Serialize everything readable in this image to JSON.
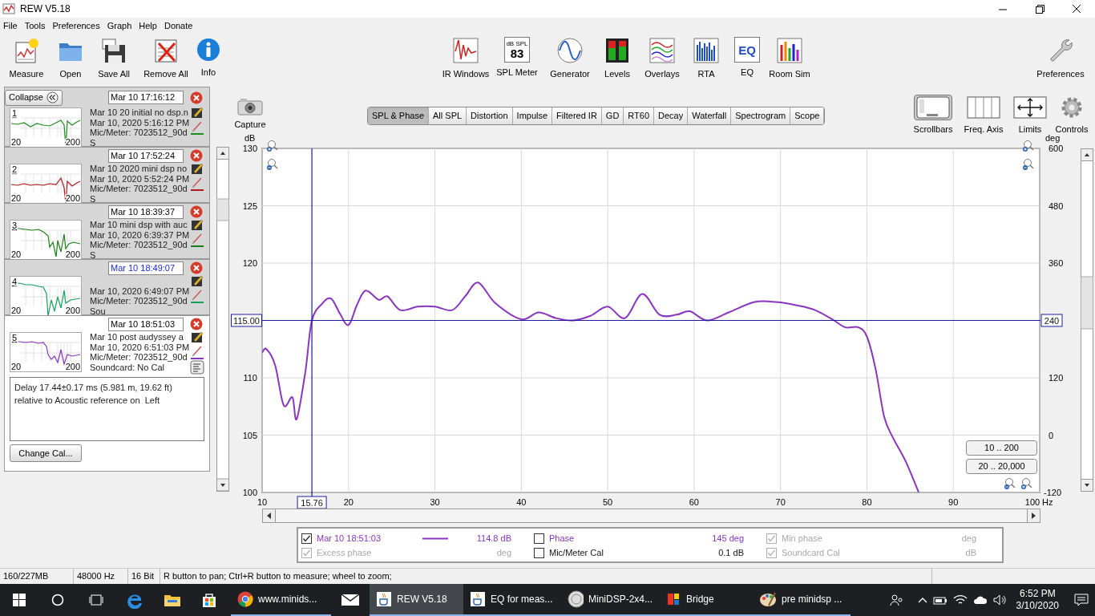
{
  "window": {
    "title": "REW V5.18"
  },
  "menu": [
    "File",
    "Tools",
    "Preferences",
    "Graph",
    "Help",
    "Donate"
  ],
  "toolbar": {
    "left": [
      {
        "label": "Measure"
      },
      {
        "label": "Open"
      },
      {
        "label": "Save All"
      },
      {
        "label": "Remove All"
      },
      {
        "label": "Info"
      }
    ],
    "center": [
      {
        "label": "IR Windows"
      },
      {
        "label": "SPL Meter",
        "icon_caption": "dB SPL",
        "icon_text": "83"
      },
      {
        "label": "Generator"
      },
      {
        "label": "Levels"
      },
      {
        "label": "Overlays"
      },
      {
        "label": "RTA"
      },
      {
        "label": "EQ",
        "icon_text": "EQ"
      },
      {
        "label": "Room Sim"
      }
    ],
    "right": [
      {
        "label": "Preferences"
      }
    ]
  },
  "measurements_panel": {
    "collapse_label": "Collapse",
    "measurements": [
      {
        "number": "1",
        "timestamp": "Mar 10 17:16:12",
        "timestamp_highlighted": false,
        "name": "Mar 10 20 initial no dsp.n",
        "date": "Mar 10, 2020 5:16:12 PM",
        "mic": "Mic/Meter: 7023512_90d",
        "soundcard": "S",
        "thumb_axis": [
          "20",
          "200"
        ],
        "color": "#1e8c1e",
        "selected": false
      },
      {
        "number": "2",
        "timestamp": "Mar 10 17:52:24",
        "timestamp_highlighted": false,
        "name": "Mar 10 2020 mini dsp no",
        "date": "Mar 10, 2020 5:52:24 PM",
        "mic": "Mic/Meter: 7023512_90d",
        "soundcard": "S",
        "thumb_axis": [
          "20",
          "200"
        ],
        "color": "#b01818",
        "selected": false
      },
      {
        "number": "3",
        "timestamp": "Mar 10 18:39:37",
        "timestamp_highlighted": false,
        "name": "Mar 10 mini dsp with auc",
        "date": "Mar 10, 2020 6:39:37 PM",
        "mic": "Mic/Meter: 7023512_90d",
        "soundcard": "S",
        "thumb_axis": [
          "20",
          "200"
        ],
        "color": "#1a7f1a",
        "selected": false
      },
      {
        "number": "4",
        "timestamp": "Mar 10 18:49:07",
        "timestamp_highlighted": true,
        "date": "Mar 10, 2020 6:49:07 PM",
        "mic": "Mic/Meter: 7023512_90d",
        "soundcard": "Sou",
        "thumb_axis": [
          "20",
          "200"
        ],
        "color": "#16a05e",
        "selected": false
      },
      {
        "number": "5",
        "timestamp": "Mar 10 18:51:03",
        "timestamp_highlighted": false,
        "name": "Mar 10 post audyssey a",
        "date": "Mar 10, 2020 6:51:03 PM",
        "mic": "Mic/Meter: 7023512_90d",
        "soundcard": "Soundcard: No Cal",
        "thumb_axis": [
          "20",
          "200"
        ],
        "color": "#8a35c0",
        "selected": true
      }
    ],
    "info_text": [
      "Delay 17.44±0.17 ms (5.981 m, 19.62 ft)",
      "relative to Acoustic reference on  Left"
    ],
    "change_cal_button": "Change Cal..."
  },
  "capture": {
    "label": "Capture"
  },
  "graph_tabs": [
    {
      "label": "SPL & Phase",
      "selected": true
    },
    {
      "label": "All SPL",
      "selected": false
    },
    {
      "label": "Distortion",
      "selected": false
    },
    {
      "label": "Impulse",
      "selected": false
    },
    {
      "label": "Filtered IR",
      "selected": false
    },
    {
      "label": "GD",
      "selected": false
    },
    {
      "label": "RT60",
      "selected": false
    },
    {
      "label": "Decay",
      "selected": false
    },
    {
      "label": "Waterfall",
      "selected": false
    },
    {
      "label": "Spectrogram",
      "selected": false
    },
    {
      "label": "Scope",
      "selected": false
    }
  ],
  "graph_tools": [
    {
      "label": "Scrollbars",
      "selected": true
    },
    {
      "label": "Freq. Axis",
      "selected": false
    },
    {
      "label": "Limits",
      "selected": false
    },
    {
      "label": "Controls",
      "selected": false
    }
  ],
  "graph": {
    "chart_data": {
      "type": "line",
      "xlabel": "Hz",
      "ylabel": "dB",
      "xlim": [
        10,
        100
      ],
      "ylim": [
        100,
        130
      ],
      "xticks": [
        10,
        20,
        30,
        40,
        50,
        60,
        70,
        80,
        90,
        100
      ],
      "yticks": [
        100,
        105,
        110,
        120,
        125,
        130
      ],
      "grid": true,
      "ref_lines": [
        {
          "axis": "x",
          "value": 15.76,
          "label": "15.76"
        },
        {
          "axis": "y",
          "value": 115,
          "label": "115.00"
        }
      ],
      "x": [
        10,
        10.5,
        11.5,
        12.5,
        13.5,
        14,
        15,
        15.76,
        17,
        18,
        19,
        20,
        21,
        22,
        23.5,
        24.5,
        26,
        28,
        30,
        32,
        33.5,
        35,
        37,
        40,
        42,
        44,
        46,
        48,
        50,
        52,
        54,
        56,
        58,
        59.5,
        61.5,
        64,
        67,
        69.5,
        72,
        74,
        76,
        77.5,
        79,
        80,
        81,
        82,
        83,
        84.5,
        86
      ],
      "series": [
        {
          "color": "#8a35c0",
          "values": [
            112.2,
            112.5,
            111.1,
            107.6,
            108.3,
            106.4,
            110.5,
            115.0,
            116.5,
            116.9,
            115.6,
            114.6,
            116.4,
            117.6,
            116.8,
            117.1,
            115.9,
            116.2,
            116.2,
            115.9,
            117.1,
            118.3,
            116.5,
            115.1,
            115.7,
            115.2,
            115.0,
            115.4,
            116.2,
            115.2,
            117.3,
            115.5,
            115.5,
            115.8,
            115.0,
            115.7,
            116.6,
            116.6,
            116.3,
            115.9,
            115.1,
            114.4,
            114.4,
            113.6,
            110.8,
            106.6,
            104.8,
            102.7,
            100.0
          ]
        }
      ]
    },
    "right_axis": {
      "label": "deg",
      "ticks": [
        "600",
        "480",
        "360",
        "120",
        "0",
        "-120"
      ]
    },
    "cursor_right_label": "240",
    "range_buttons": [
      "10 .. 200",
      "20 .. 20,000"
    ]
  },
  "legend": {
    "items": [
      {
        "kind": "measurement",
        "label": "Mar 10 18:51:03",
        "value": "114.8 dB",
        "checked": true,
        "disabled": false,
        "color": "#8a35c0"
      },
      {
        "kind": "trace",
        "label": "Phase",
        "value": "145 deg",
        "checked": false,
        "disabled": false,
        "color": "#8a35c0"
      },
      {
        "kind": "trace",
        "label": "Min phase",
        "value": "deg",
        "checked": true,
        "disabled": true
      },
      {
        "kind": "trace",
        "label": "Excess phase",
        "value": "deg",
        "checked": true,
        "disabled": true
      },
      {
        "kind": "trace",
        "label": "Mic/Meter Cal",
        "value": "0.1 dB",
        "checked": false,
        "disabled": false
      },
      {
        "kind": "trace",
        "label": "Soundcard Cal",
        "value": "dB",
        "checked": true,
        "disabled": true
      }
    ]
  },
  "status_bar": [
    "160/227MB",
    "48000 Hz",
    "16 Bit",
    "R button to pan; Ctrl+R button to measure; wheel to zoom;"
  ],
  "taskbar": {
    "items": [
      {
        "kind": "pin"
      },
      {
        "kind": "pin"
      },
      {
        "kind": "pin"
      },
      {
        "kind": "pin"
      },
      {
        "kind": "pin"
      },
      {
        "kind": "pin"
      },
      {
        "kind": "window",
        "label": "www.minids...",
        "selected": false
      },
      {
        "kind": "pin"
      },
      {
        "kind": "window",
        "label": "REW V5.18",
        "selected": true
      },
      {
        "kind": "window",
        "label": "EQ for meas...",
        "selected": false
      },
      {
        "kind": "window",
        "label": "MiniDSP-2x4...",
        "selected": false
      },
      {
        "kind": "window",
        "label": "Bridge",
        "selected": false
      },
      {
        "kind": "window",
        "label": "pre minidsp ...",
        "selected": false
      }
    ],
    "clock": {
      "time": "6:52 PM",
      "date": "3/10/2020"
    }
  }
}
